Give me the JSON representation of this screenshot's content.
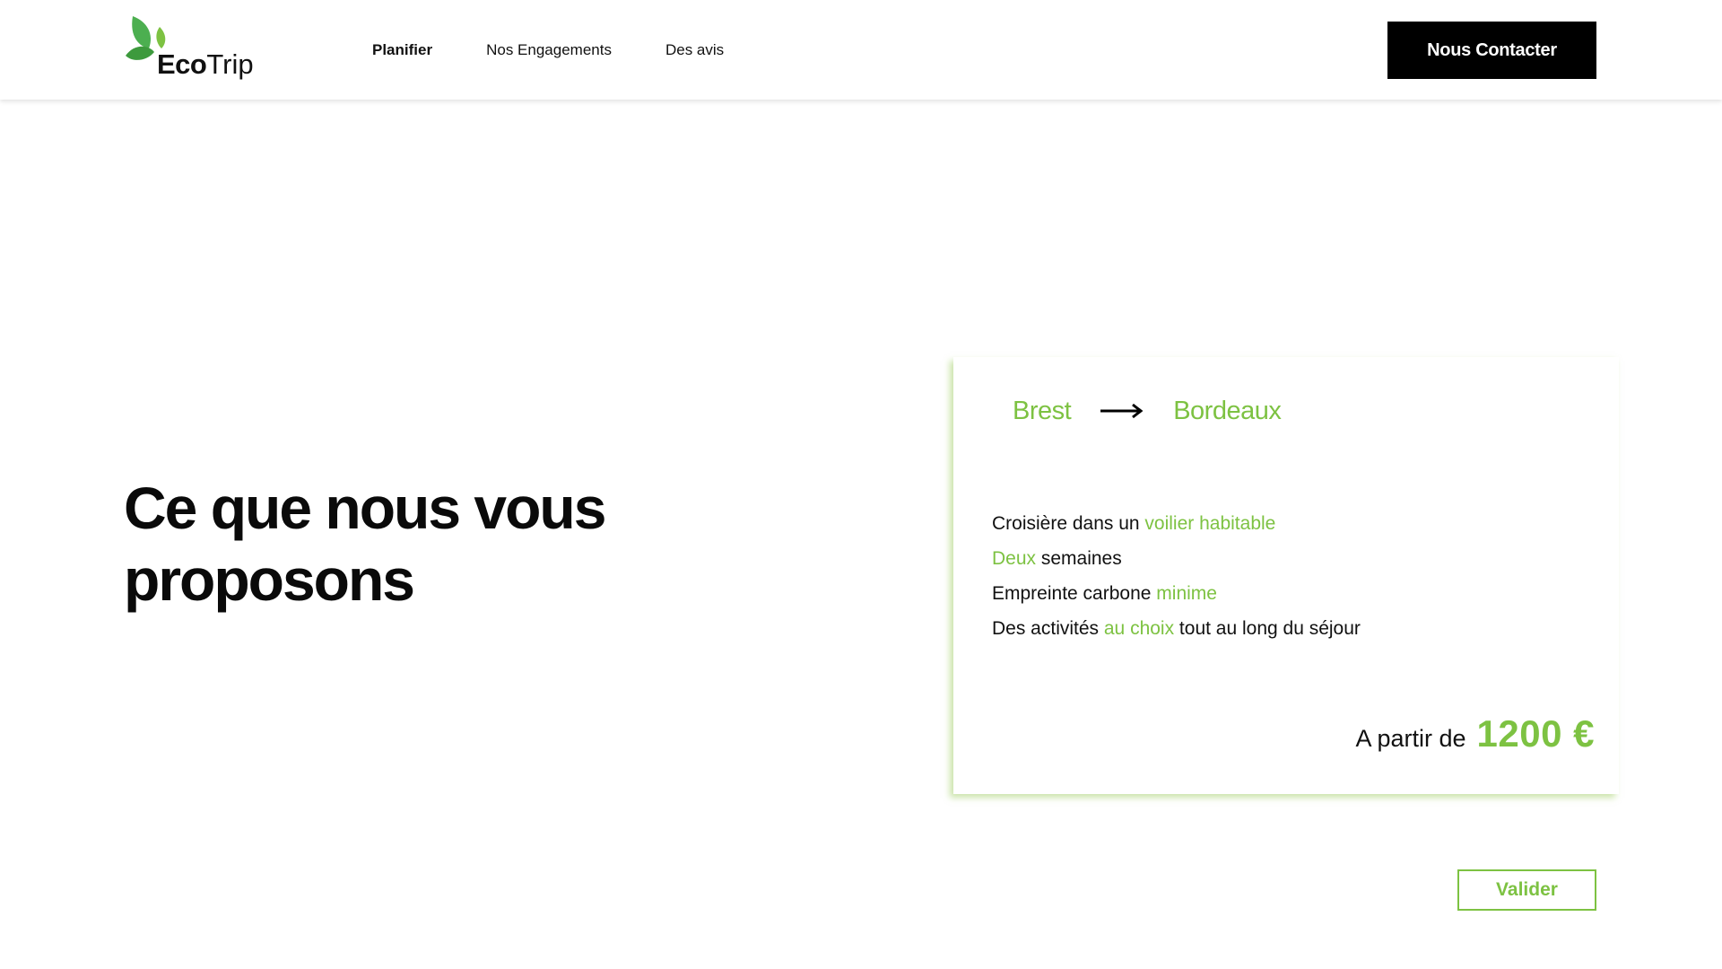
{
  "header": {
    "logo": {
      "bold": "Eco",
      "regular": "Trip",
      "icon": "leaf-icon"
    },
    "nav": [
      {
        "label": "Planifier",
        "active": true
      },
      {
        "label": "Nos Engagements",
        "active": false
      },
      {
        "label": "Des avis",
        "active": false
      }
    ],
    "contact_label": "Nous Contacter"
  },
  "hero": {
    "title_line1": "Ce que nous vous",
    "title_line2": "proposons"
  },
  "offer": {
    "from_city": "Brest",
    "to_city": "Bordeaux",
    "arrow_icon": "arrow-right-icon",
    "features": [
      {
        "pre": "Croisière dans un ",
        "hl": "voilier habitable",
        "post": ""
      },
      {
        "pre": "",
        "hl": "Deux",
        "post": " semaines"
      },
      {
        "pre": "Empreinte carbone ",
        "hl": "minime",
        "post": ""
      },
      {
        "pre": "Des activités ",
        "hl": "au choix",
        "post": " tout au long du séjour"
      }
    ],
    "price_label": "A partir de",
    "price_value": "1200 €"
  },
  "actions": {
    "validate_label": "Valider"
  },
  "colors": {
    "accent": "#7dc242",
    "text": "#111111",
    "button_bg": "#000000"
  }
}
